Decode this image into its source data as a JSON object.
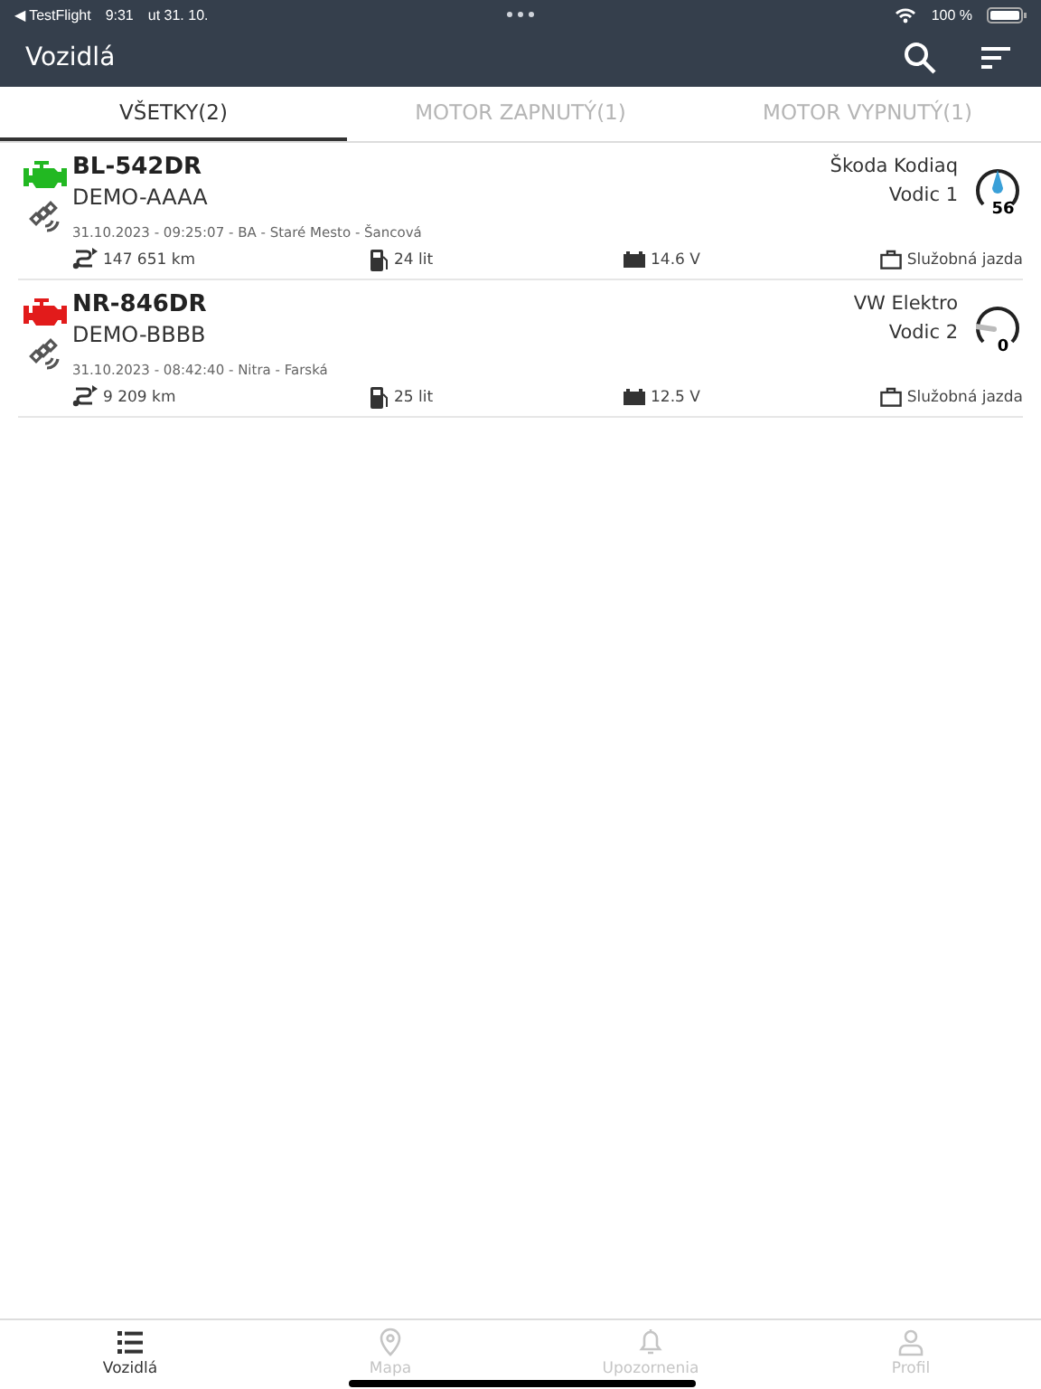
{
  "status_bar": {
    "back_app": "◀ TestFlight",
    "time": "9:31",
    "date": "ut 31. 10.",
    "battery": "100 %"
  },
  "header": {
    "title": "Vozidlá"
  },
  "tabs": [
    {
      "label": "VŠETKY(2)",
      "selected": true
    },
    {
      "label": "MOTOR ZAPNUTÝ(1)",
      "selected": false
    },
    {
      "label": "MOTOR VYPNUTÝ(1)",
      "selected": false
    }
  ],
  "vehicles": [
    {
      "plate": "BL-542DR",
      "name": "DEMO-AAAA",
      "engine_on": true,
      "last_position": "31.10.2023 - 09:25:07 - BA - Staré Mesto - Šancová",
      "odometer": "147 651 km",
      "fuel": "24 lit",
      "voltage": "14.6 V",
      "trip_type": "Služobná jazda",
      "model": "Škoda Kodiaq",
      "driver": "Vodic 1",
      "speed": "56"
    },
    {
      "plate": "NR-846DR",
      "name": "DEMO-BBBB",
      "engine_on": false,
      "last_position": "31.10.2023 - 08:42:40 - Nitra - Farská",
      "odometer": "9 209 km",
      "fuel": "25 lit",
      "voltage": "12.5 V",
      "trip_type": "Služobná jazda",
      "model": "VW Elektro",
      "driver": "Vodic 2",
      "speed": "0"
    }
  ],
  "bottom_nav": [
    {
      "label": "Vozidlá",
      "selected": true
    },
    {
      "label": "Mapa",
      "selected": false
    },
    {
      "label": "Upozornenia",
      "selected": false
    },
    {
      "label": "Profil",
      "selected": false
    }
  ]
}
